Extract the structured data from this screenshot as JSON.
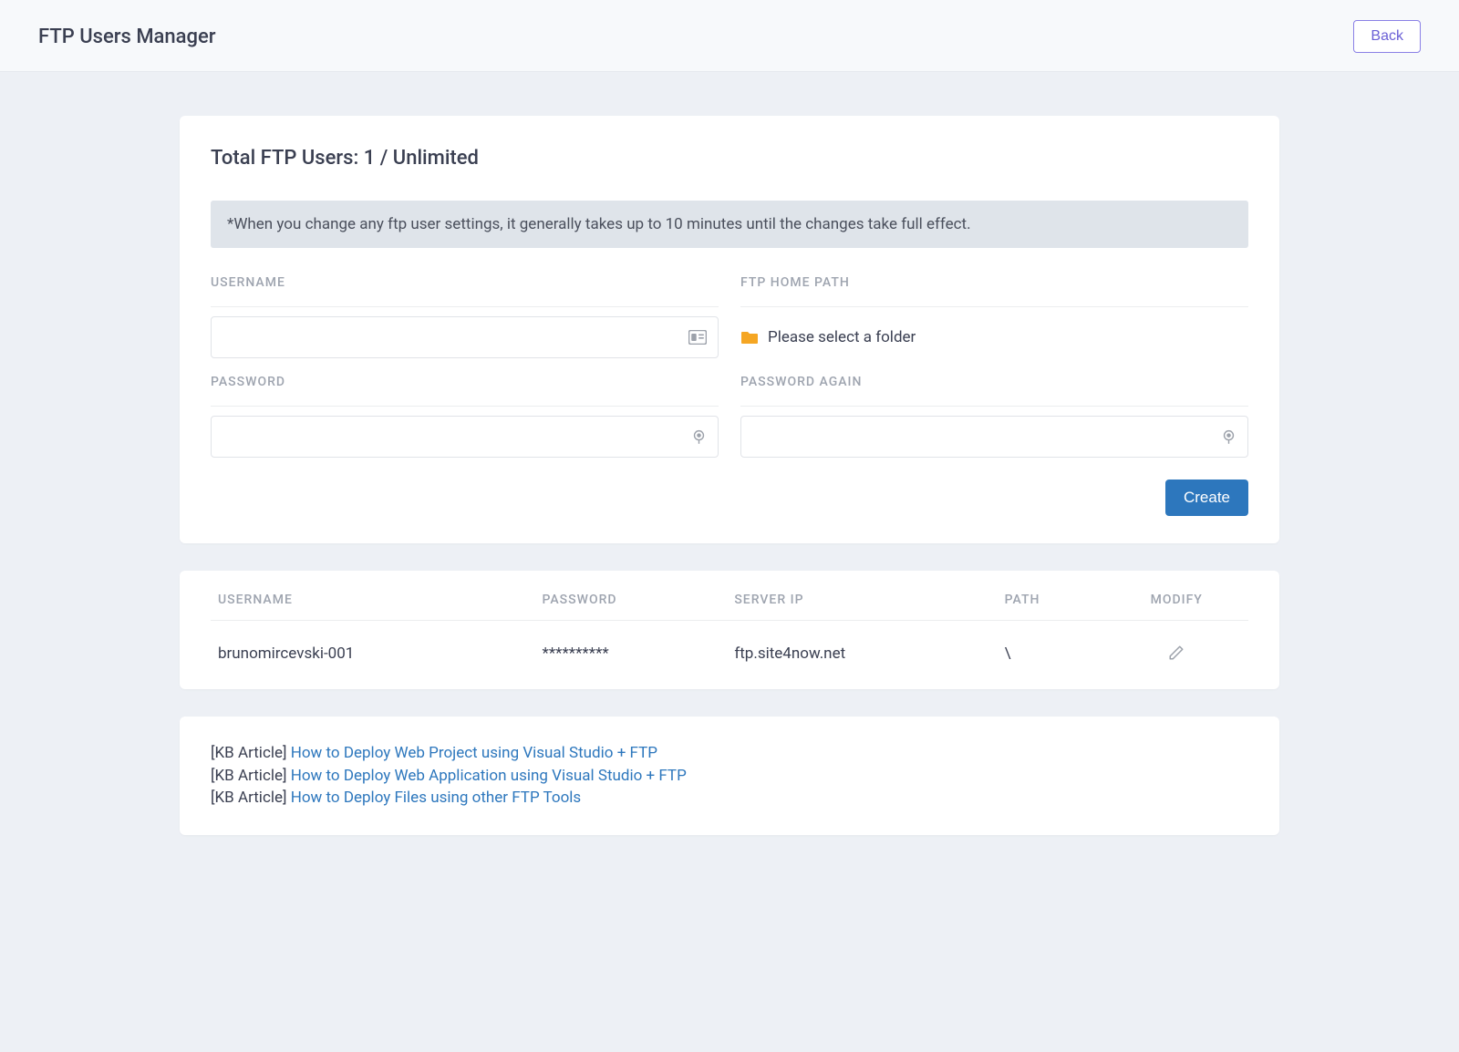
{
  "header": {
    "title": "FTP Users Manager",
    "back_label": "Back"
  },
  "summary": {
    "label": "Total FTP Users:",
    "value": "1 / Unlimited"
  },
  "notice": "*When you change any ftp user settings, it generally takes up to 10 minutes until the changes take full effect.",
  "form": {
    "username": {
      "label": "Username",
      "value": ""
    },
    "home_path": {
      "label": "FTP Home Path",
      "placeholder": "Please select a folder"
    },
    "password": {
      "label": "Password",
      "value": ""
    },
    "password_again": {
      "label": "Password Again",
      "value": ""
    },
    "create_label": "Create"
  },
  "table": {
    "headers": [
      "Username",
      "Password",
      "Server IP",
      "Path",
      "Modify"
    ],
    "rows": [
      {
        "username": "brunomircevski-001",
        "password": "**********",
        "server_ip": "ftp.site4now.net",
        "path": "\\"
      }
    ]
  },
  "kb": {
    "prefix": "[KB Article]",
    "items": [
      "How to Deploy Web Project using Visual Studio + FTP",
      "How to Deploy Web Application using Visual Studio + FTP",
      "How to Deploy Files using other FTP Tools"
    ]
  }
}
